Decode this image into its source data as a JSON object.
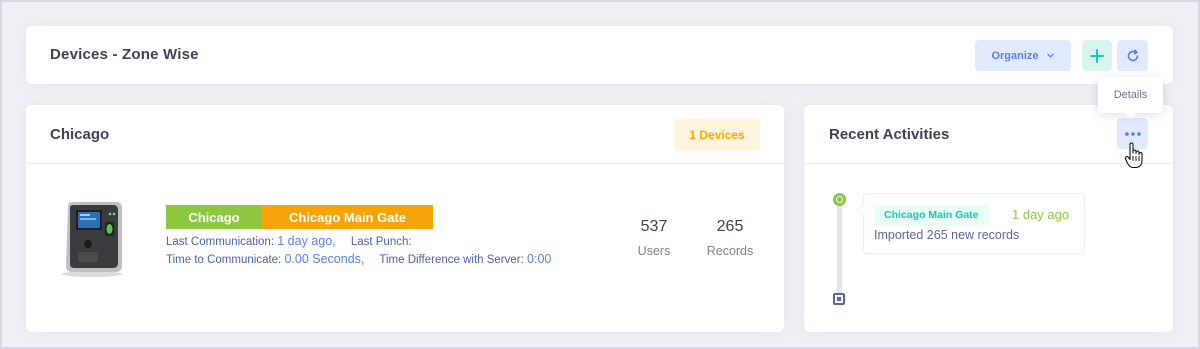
{
  "header": {
    "title": "Devices - Zone Wise",
    "organize_label": "Organize",
    "icons": {
      "organize": "chevron-down-icon",
      "add": "plus-icon",
      "refresh": "refresh-icon"
    }
  },
  "tooltip": {
    "text": "Details"
  },
  "zone": {
    "title": "Chicago",
    "device_count_label": "1 Devices",
    "device": {
      "zone_label": "Chicago",
      "gate_label": "Chicago Main Gate",
      "last_communication_label": "Last Communication:",
      "last_communication_value": "1 day ago,",
      "last_punch_label": "Last Punch:",
      "last_punch_value": "",
      "time_to_communicate_label": "Time to Communicate:",
      "time_to_communicate_value": "0.00 Seconds,",
      "time_difference_label": "Time Difference with Server:",
      "time_difference_value": "0:00",
      "users_count": "537",
      "users_label": "Users",
      "records_count": "265",
      "records_label": "Records"
    }
  },
  "activities": {
    "title": "Recent Activities",
    "details_icon": "more-horizontal-icon",
    "items": [
      {
        "tag": "Chicago Main Gate",
        "time": "1 day ago",
        "description": "Imported 265 new records"
      }
    ]
  },
  "colors": {
    "zone_label": "#8dc63f",
    "gate_label": "#f7a30a",
    "badge_text": "#ffa800",
    "badge_bg": "#fff4de",
    "primary": "#5b7fe8",
    "success": "#1bc5bd"
  }
}
